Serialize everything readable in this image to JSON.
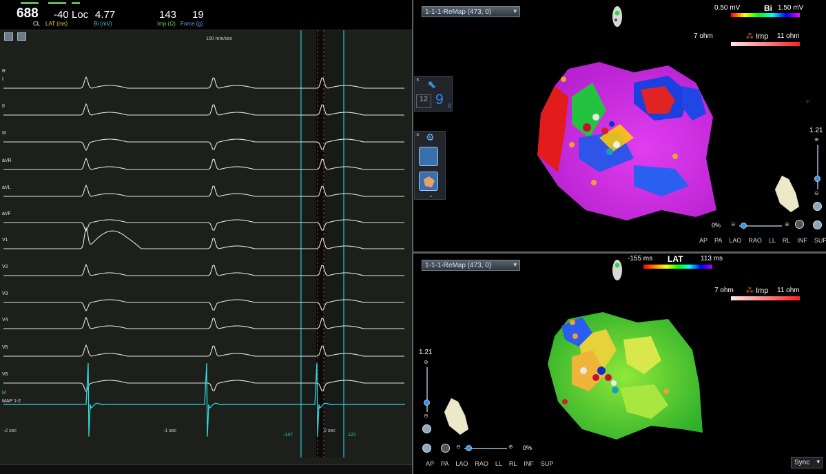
{
  "header": {
    "cl_value": "688",
    "cl_label": "CL",
    "lat_value": "-40",
    "lat_label": "LAT (ms)",
    "loc_label": "Loc",
    "bi_value": "4.77",
    "bi_label": "Bi (mV)",
    "imp_value": "143",
    "imp_label": "Imp (Ω)",
    "force_value": "19",
    "force_label": "Force (g)"
  },
  "ecg": {
    "sweep_speed": "100 mm/sec",
    "leads": [
      "R",
      "I",
      "II",
      "III",
      "aVR",
      "aVL",
      "aVF",
      "V1",
      "V2",
      "V3",
      "V4",
      "V5",
      "V6"
    ],
    "map_lead_m": "M",
    "map_lead": "MAP 1-2",
    "time_labels": [
      "-2 sec",
      "-1 sec",
      "0 sec"
    ],
    "window_left": "-147",
    "window_right": "122"
  },
  "map_top": {
    "selector": "1-1-1-ReMap (473, 0)",
    "bi_min": "0.50 mV",
    "bi_label": "Bi",
    "bi_max": "1.50 mV",
    "imp_min": "7 ohm",
    "imp_label": "Imp",
    "imp_max": "11 ohm",
    "zoom": "1.21",
    "transparency": "0%",
    "views": [
      "AP",
      "PA",
      "LAO",
      "RAO",
      "LL",
      "RL",
      "INF",
      "SUP"
    ]
  },
  "map_bottom": {
    "selector": "1-1-1-ReMap (473, 0)",
    "lat_min": "-155 ms",
    "lat_label": "LAT",
    "lat_max": "113 ms",
    "imp_min": "7 ohm",
    "imp_label": "Imp",
    "imp_max": "11 ohm",
    "zoom": "1.21",
    "transparency": "0%",
    "views": [
      "AP",
      "PA",
      "LAO",
      "RAO",
      "LL",
      "RL",
      "INF",
      "SUP"
    ],
    "sync_label": "Sync"
  },
  "palette": {
    "num_a": "12",
    "num_b": "9",
    "num_b_unit": "g"
  },
  "colors": {
    "ecg_bg": "#1c1f1a",
    "ecg_trace": "#e6e6e6",
    "map_trace": "#33d6e0",
    "cursor": "#2ec6d4",
    "lat_label": "#e8d44a",
    "imp_label": "#57d15a",
    "force_label": "#5aa8ff",
    "bi_label": "#39d0e6"
  }
}
